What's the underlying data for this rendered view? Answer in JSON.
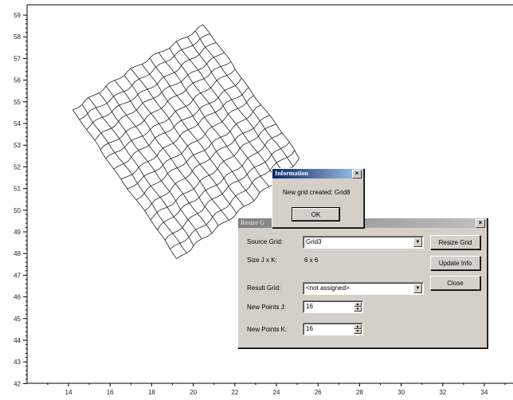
{
  "plot": {
    "y_ticks": [
      "59",
      "58",
      "57",
      "56",
      "55",
      "54",
      "53",
      "52",
      "51",
      "50",
      "49",
      "48",
      "47",
      "46",
      "45",
      "44",
      "43",
      "42"
    ],
    "x_ticks": [
      "14",
      "16",
      "18",
      "20",
      "22",
      "24",
      "26",
      "28",
      "30",
      "32",
      "34"
    ],
    "grid_color": "#222222"
  },
  "info_dialog": {
    "title": "Information",
    "message": "New grid created: Grid8",
    "ok_label": "OK"
  },
  "resize_dialog": {
    "title": "Resize G",
    "source_grid_label": "Source Grid:",
    "source_grid_value": "Grid3",
    "size_label": "Size J x K:",
    "size_value": "6 x 6",
    "result_grid_label": "Result Grid:",
    "result_grid_value": "<not assigned>",
    "new_points_j_label": "New Points J:",
    "new_points_j_value": "16",
    "new_points_k_label": "New Points K:",
    "new_points_k_value": "16",
    "resize_button": "Resize Grid",
    "update_button": "Update Info",
    "close_button": "Close"
  },
  "colors": {
    "dialog_face": "#d4d0c8",
    "titlebar_active": "#0a246a",
    "titlebar_inactive": "#808080"
  }
}
